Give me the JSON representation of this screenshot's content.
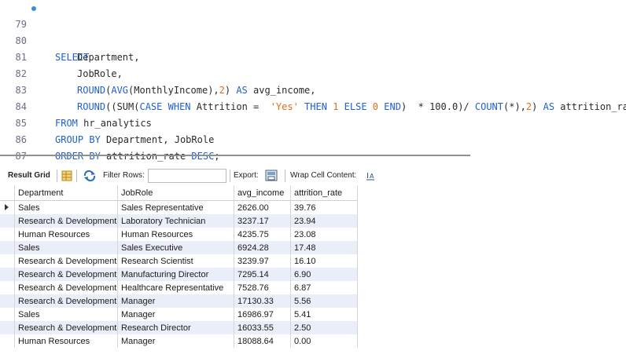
{
  "editor": {
    "lines": [
      {
        "num": "79"
      },
      {
        "num": "80",
        "text": "Department,"
      },
      {
        "num": "81",
        "text": "JobRole,"
      },
      {
        "num": "82"
      },
      {
        "num": "83"
      },
      {
        "num": "84"
      },
      {
        "num": "85"
      },
      {
        "num": "86"
      },
      {
        "num": "87"
      }
    ],
    "tokens": {
      "select": "SELECT",
      "round": "ROUND",
      "avg": "AVG",
      "monthly": "(MonthlyIncome),",
      "two": "2",
      "as": "AS",
      "avg_income": "avg_income,",
      "round2": "ROUND",
      "sum": "((SUM(",
      "case": "CASE",
      "when": "WHEN",
      "attr_eq": "Attrition =  ",
      "yes": "'Yes'",
      "then": "THEN",
      "one": "1",
      "else": "ELSE",
      "zero": "0",
      "end": "END",
      "mult": ")  * 100.0)/ ",
      "count": "COUNT",
      "count_args": "(*),",
      "two2": "2",
      "close": ") ",
      "as2": "AS",
      "attr_rate": " attrition_rate",
      "from": "FROM",
      "table": " hr_analytics",
      "groupby": "GROUP BY",
      "group_cols": " Department, JobRole",
      "orderby": "ORDER BY",
      "order_col": " attrition_rate ",
      "desc": "DESC",
      "semi": ";"
    }
  },
  "toolbar": {
    "result_grid": "Result Grid",
    "filter_rows": "Filter Rows:",
    "export": "Export:",
    "wrap_cell": "Wrap Cell Content:"
  },
  "grid": {
    "columns": [
      "Department",
      "JobRole",
      "avg_income",
      "attrition_rate"
    ],
    "rows": [
      [
        "Sales",
        "Sales Representative",
        "2626.00",
        "39.76"
      ],
      [
        "Research & Development",
        "Laboratory Technician",
        "3237.17",
        "23.94"
      ],
      [
        "Human Resources",
        "Human Resources",
        "4235.75",
        "23.08"
      ],
      [
        "Sales",
        "Sales Executive",
        "6924.28",
        "17.48"
      ],
      [
        "Research & Development",
        "Research Scientist",
        "3239.97",
        "16.10"
      ],
      [
        "Research & Development",
        "Manufacturing Director",
        "7295.14",
        "6.90"
      ],
      [
        "Research & Development",
        "Healthcare Representative",
        "7528.76",
        "6.87"
      ],
      [
        "Research & Development",
        "Manager",
        "17130.33",
        "5.56"
      ],
      [
        "Sales",
        "Manager",
        "16986.97",
        "5.41"
      ],
      [
        "Research & Development",
        "Research Director",
        "16033.55",
        "2.50"
      ],
      [
        "Human Resources",
        "Manager",
        "18088.64",
        "0.00"
      ]
    ]
  }
}
